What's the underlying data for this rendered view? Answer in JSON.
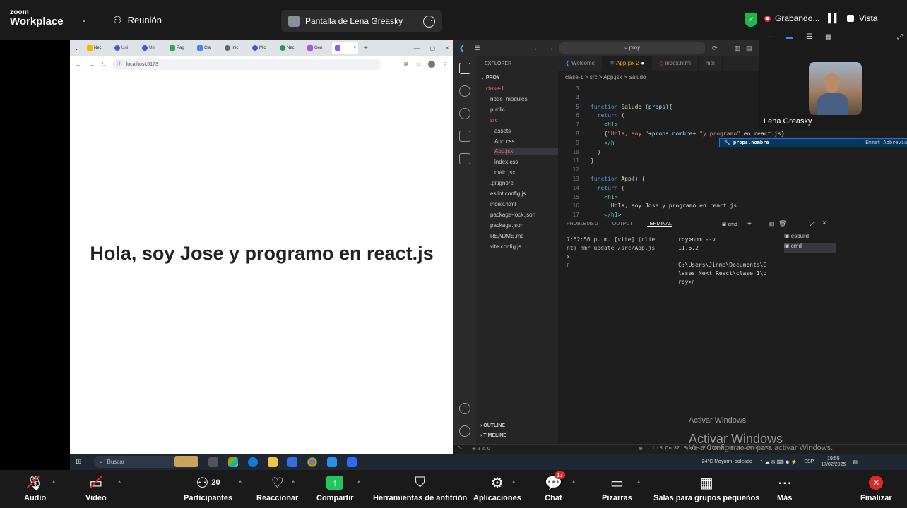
{
  "zoom": {
    "logo_top": "zoom",
    "logo_bottom": "Workplace",
    "meeting_label": "Reunión",
    "share_title": "Pantalla de Lena Greasky",
    "recording_label": "Grabando...",
    "view_label": "Vista",
    "participant_name": "Lena Greasky"
  },
  "browser": {
    "tabs": [
      "Nec",
      "Uni",
      "Uni",
      "Pag",
      "Cla",
      "Inic",
      "Mic",
      "Nec",
      "Gen",
      ""
    ],
    "url": "localhost:5173",
    "heading": "Hola, soy Jose y programo en react.js"
  },
  "taskbar": {
    "search_placeholder": "Buscar",
    "weather": "24°C  Mayorm. soleado",
    "lang": "ESP",
    "time": "19:55",
    "date": "17/02/2025"
  },
  "vscode": {
    "search": "proy",
    "explorer_title": "EXPLORER",
    "project": "PROY",
    "tree": [
      {
        "name": "clase-1",
        "indent": 0,
        "color": "#e06c75"
      },
      {
        "name": "node_modules",
        "indent": 1,
        "color": "#cccccc"
      },
      {
        "name": "public",
        "indent": 1,
        "color": "#cccccc"
      },
      {
        "name": "src",
        "indent": 1,
        "color": "#e06c75"
      },
      {
        "name": "assets",
        "indent": 2,
        "color": "#cccccc"
      },
      {
        "name": "App.css",
        "indent": 2,
        "color": "#cccccc"
      },
      {
        "name": "App.jsx",
        "indent": 2,
        "color": "#e06c75"
      },
      {
        "name": "index.css",
        "indent": 2,
        "color": "#cccccc"
      },
      {
        "name": "main.jsx",
        "indent": 2,
        "color": "#cccccc"
      },
      {
        "name": ".gitignore",
        "indent": 1,
        "color": "#cccccc"
      },
      {
        "name": "eslint.config.js",
        "indent": 1,
        "color": "#cccccc"
      },
      {
        "name": "index.html",
        "indent": 1,
        "color": "#cccccc"
      },
      {
        "name": "package-lock.json",
        "indent": 1,
        "color": "#cccccc"
      },
      {
        "name": "package.json",
        "indent": 1,
        "color": "#cccccc"
      },
      {
        "name": "README.md",
        "indent": 1,
        "color": "#cccccc"
      },
      {
        "name": "vite.config.js",
        "indent": 1,
        "color": "#cccccc"
      }
    ],
    "outline": "OUTLINE",
    "timeline": "TIMELINE",
    "tabs": [
      "Welcome",
      "App.jsx 2",
      "index.html",
      "mai"
    ],
    "breadcrumb": "clase-1 > src > App.jsx > Saludo",
    "code": [
      {
        "n": "3",
        "html": ""
      },
      {
        "n": "4",
        "html": ""
      },
      {
        "n": "5",
        "html": "<span class='kw'>function</span> <span class='fn'>Saludo</span> (<span class='pr'>props</span>){"
      },
      {
        "n": "6",
        "html": "  <span class='kw'>return</span> ("
      },
      {
        "n": "7",
        "html": "    <span class='tg'>&lt;h1&gt;</span>"
      },
      {
        "n": "8",
        "html": "    {<span class='st'>\"Hola, soy \"</span>+<span class='pr'>props.nombre</span>+ <span class='st'>\"y programo\"</span> en react.js}"
      },
      {
        "n": "9",
        "html": "    <span class='tg'>&lt;/h</span>"
      },
      {
        "n": "10",
        "html": "  )"
      },
      {
        "n": "11",
        "html": "}"
      },
      {
        "n": "12",
        "html": ""
      },
      {
        "n": "13",
        "html": "<span class='kw'>function</span> <span class='fn'>App</span>() {"
      },
      {
        "n": "14",
        "html": "  <span class='kw'>return</span> ("
      },
      {
        "n": "15",
        "html": "    <span class='tg'>&lt;h1&gt;</span>"
      },
      {
        "n": "16",
        "html": "      Hola, soy Jose y programo en react.js"
      },
      {
        "n": "17",
        "html": "    <span class='tg'>&lt;/h1&gt;</span>"
      }
    ],
    "suggestion": "props.nombre",
    "suggestion_hint": "Emmet Abbreviation",
    "panel_tabs": [
      "PROBLEMS 2",
      "OUTPUT",
      "TERMINAL"
    ],
    "terminal_shell": "cmd",
    "terminal_left": "7:52:56 p. m. [vite] (clie\nnt) hmr update /src/App.js\nx\n▯",
    "terminal_right": "roy>npm --v\n11.6.2\n\nC:\\Users\\Jinma\\Documents\\C\nlases Next React\\clase 1\\p\nroy>▯",
    "terminal_list": [
      "esbuild",
      "cmd"
    ],
    "status": "⊗ 2  ⚠ 0",
    "status_right": "Ln 8, Col 32   Spaces: 2   UTF-8   LF   JavaScript JSX",
    "activate_title": "Activar Windows",
    "activate_sub": "Ve a Configuración para activar Windows."
  },
  "toolbar": {
    "audio": "Audio",
    "video": "Video",
    "participants": "Participantes",
    "participants_count": "20",
    "react": "Reaccionar",
    "share": "Compartir",
    "host_tools": "Herramientas de anfitrión",
    "apps": "Aplicaciones",
    "chat": "Chat",
    "chat_badge": "17",
    "whiteboards": "Pizarras",
    "breakout": "Salas para grupos pequeños",
    "more": "Más",
    "end": "Finalizar"
  }
}
